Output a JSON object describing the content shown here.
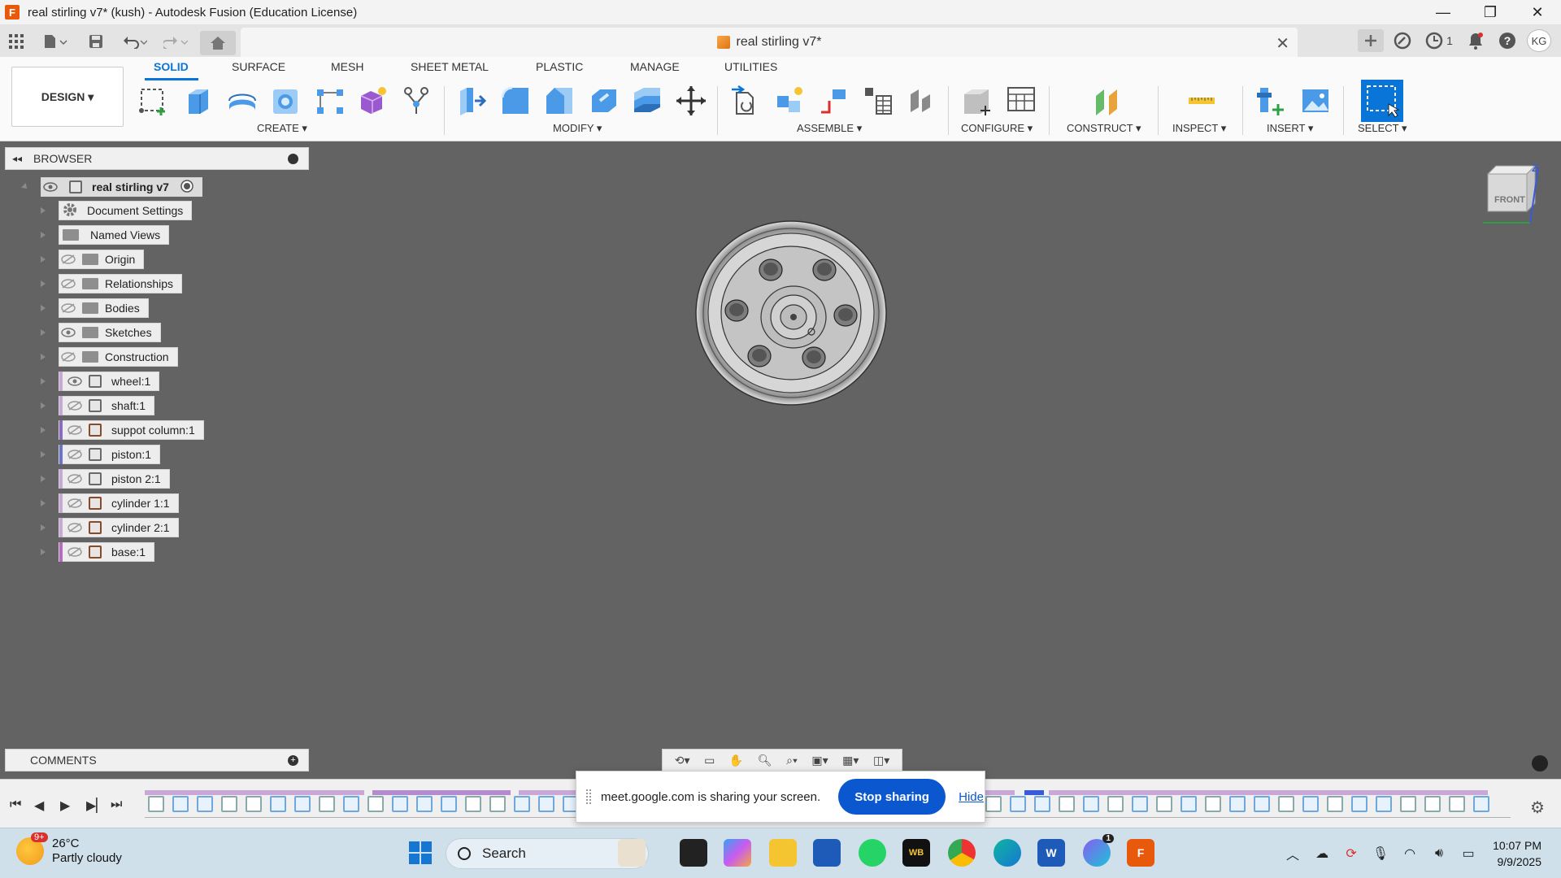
{
  "titlebar": {
    "app_icon": "F",
    "title": "real stirling v7* (kush) - Autodesk Fusion (Education License)",
    "minimize": "—",
    "restore": "❐",
    "close": "✕"
  },
  "tabbar": {
    "doc_title": "real stirling v7*",
    "close": "✕",
    "job_count": "1",
    "avatar": "KG"
  },
  "ribbon": {
    "workspace": "DESIGN ▾",
    "tabs": [
      "SOLID",
      "SURFACE",
      "MESH",
      "SHEET METAL",
      "PLASTIC",
      "MANAGE",
      "UTILITIES"
    ],
    "groups": [
      "CREATE ▾",
      "MODIFY ▾",
      "ASSEMBLE ▾",
      "CONFIGURE ▾",
      "CONSTRUCT ▾",
      "INSPECT ▾",
      "INSERT ▾",
      "SELECT ▾"
    ]
  },
  "browser": {
    "title": "BROWSER",
    "root": "real stirling v7",
    "items": [
      {
        "label": "Document Settings"
      },
      {
        "label": "Named Views"
      },
      {
        "label": "Origin"
      },
      {
        "label": "Relationships"
      },
      {
        "label": "Bodies"
      },
      {
        "label": "Sketches"
      },
      {
        "label": "Construction"
      },
      {
        "label": "wheel:1"
      },
      {
        "label": "shaft:1"
      },
      {
        "label": "suppot column:1"
      },
      {
        "label": "piston:1"
      },
      {
        "label": "piston 2:1"
      },
      {
        "label": "cylinder 1:1"
      },
      {
        "label": "cylinder 2:1"
      },
      {
        "label": "base:1"
      }
    ]
  },
  "viewcube": {
    "face": "FRONT",
    "axis": "Z"
  },
  "comments": {
    "title": "COMMENTS"
  },
  "share_bar": {
    "message": "meet.google.com is sharing your screen.",
    "stop": "Stop sharing",
    "hide": "Hide"
  },
  "taskbar": {
    "weather_temp": "26°C",
    "weather_desc": "Partly cloudy",
    "weather_badge": "9+",
    "search": "Search",
    "time": "10:07 PM",
    "date": "9/9/2025",
    "copilot_badge": "1"
  },
  "colors": {
    "accent": "#0a75d9",
    "viewport": "#636363",
    "share_button": "#0b57d0",
    "fusion_orange": "#e8590c"
  }
}
